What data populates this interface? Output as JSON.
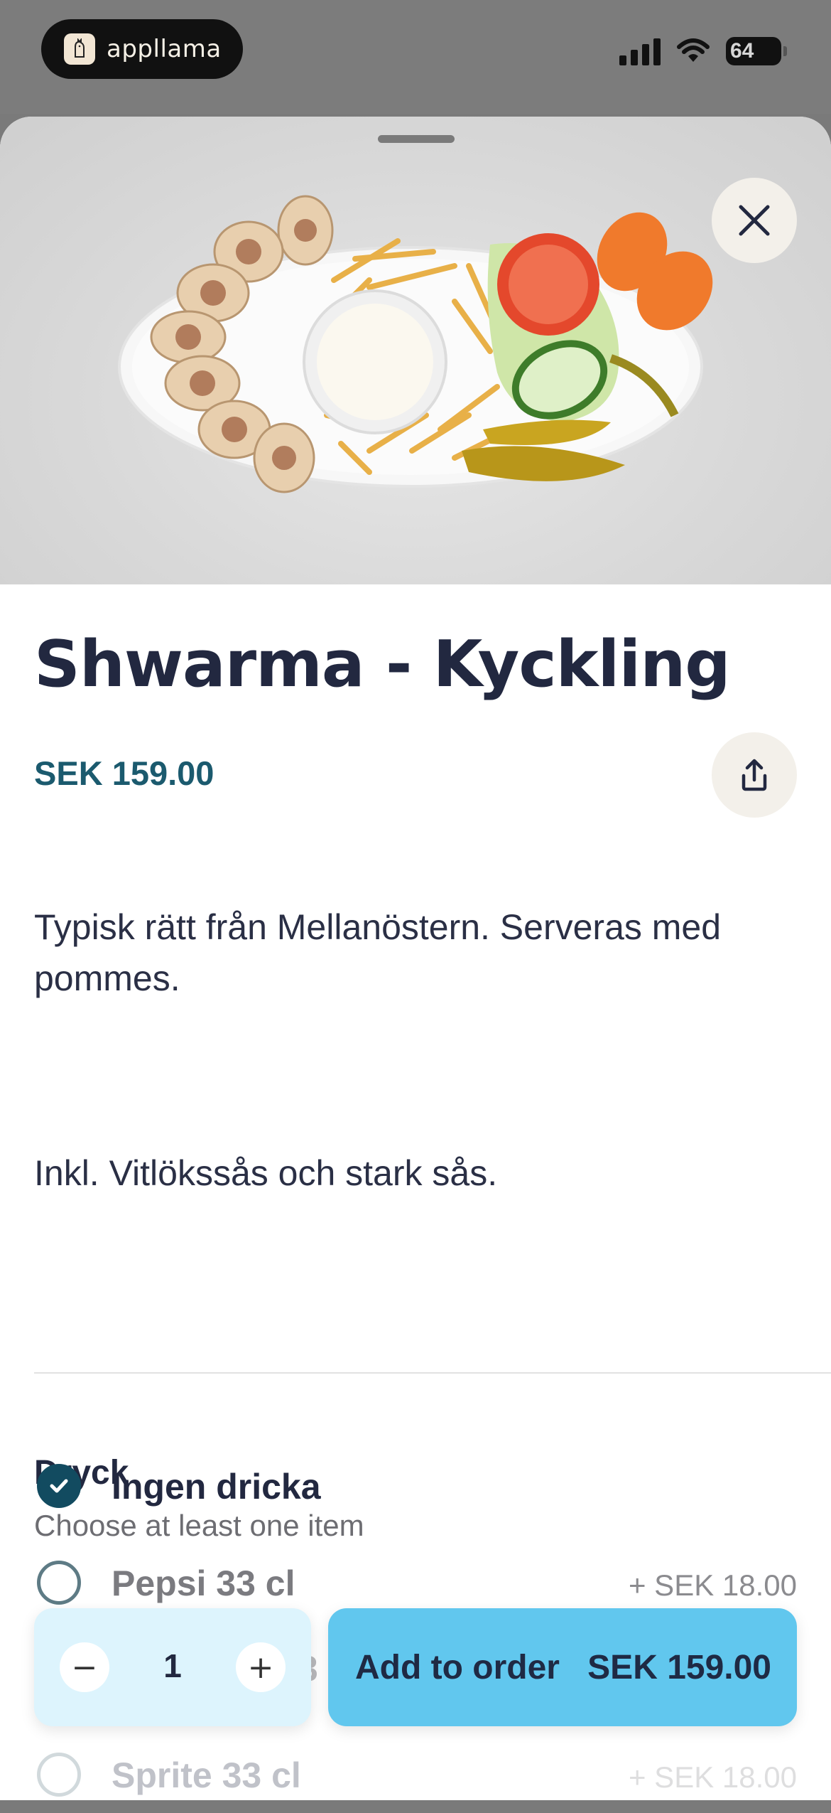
{
  "status_bar": {
    "app_name": "appllama",
    "battery": "64"
  },
  "product": {
    "title": "Shwarma - Kyckling",
    "price": "SEK 159.00",
    "description_1": "Typisk rätt från Mellanöstern. Serveras med pommes.",
    "description_2": "Inkl. Vitlökssås och stark sås."
  },
  "options_group": {
    "title": "Dryck",
    "subtitle": "Choose at least one item",
    "options": [
      {
        "label": "Ingen dricka",
        "price": "",
        "selected": true
      },
      {
        "label": "Pepsi 33 cl",
        "price": "+ SEK 18.00",
        "selected": false
      },
      {
        "label": "Sprite 33 cl",
        "price": "+ SEK 18.00",
        "selected": false
      }
    ]
  },
  "bottom_bar": {
    "quantity": "1",
    "minus": "−",
    "plus": "+",
    "add_label": "Add to order",
    "add_price": "SEK 159.00",
    "hidden_peek": "3"
  },
  "colors": {
    "accent_dark": "#124b60",
    "price_teal": "#1b5a6e",
    "add_button": "#61c7ee",
    "qty_bg": "#ddf4fd",
    "title": "#222840"
  },
  "icons": {
    "close": "close-icon",
    "share": "share-icon",
    "check": "checkmark-icon"
  }
}
